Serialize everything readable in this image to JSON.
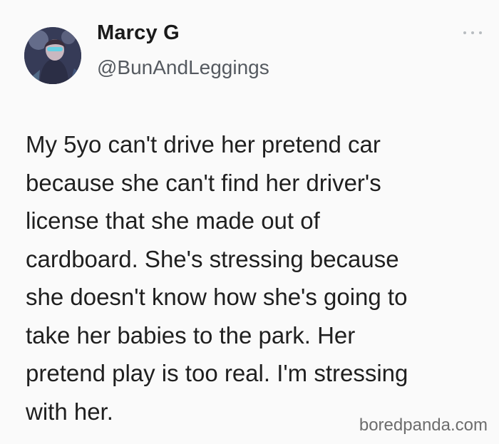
{
  "author": {
    "display_name": "Marcy G",
    "handle": "@BunAndLeggings",
    "avatar_icon": "profile-avatar"
  },
  "tweet": {
    "lines": [
      "My 5yo can't drive her pretend car",
      "because she can't find her driver's",
      "license that she made out of",
      "cardboard. She's stressing because",
      "she doesn't know how she's going to",
      "take her babies to the park. Her",
      "pretend play is too real. I'm stressing",
      "with her."
    ]
  },
  "menu": {
    "icon": "more-options-icon"
  },
  "watermark": {
    "text": "boredpanda.com"
  },
  "colors": {
    "background": "#fafafa",
    "text": "#1f1f1f",
    "handle": "#555a60",
    "watermark": "#6d6d6d"
  }
}
